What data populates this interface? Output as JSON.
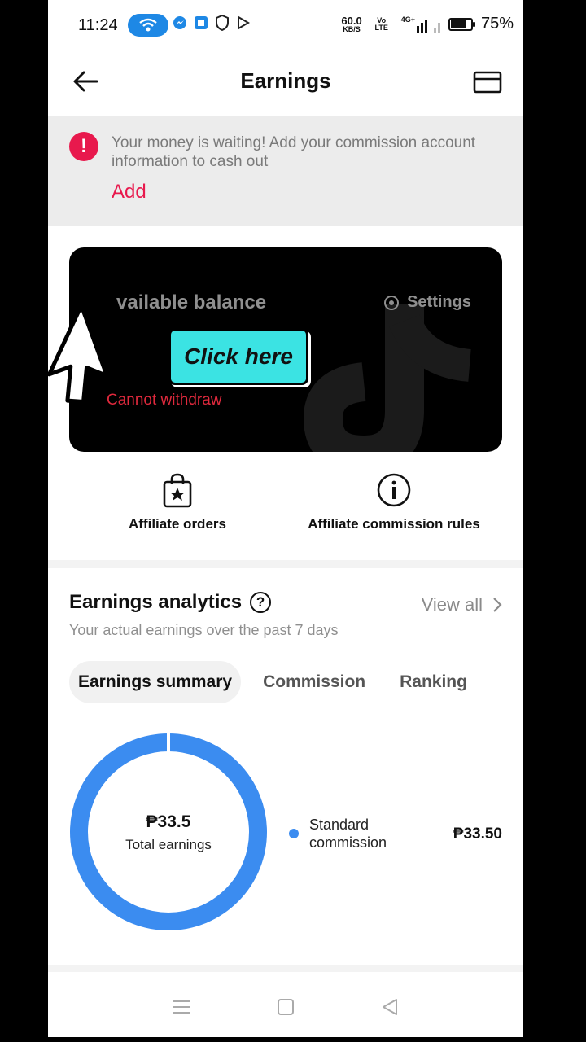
{
  "status_bar": {
    "time": "11:24",
    "net_speed": "60.0",
    "net_unit": "KB/S",
    "net_tech": "Vo LTE",
    "signal": "4G+",
    "battery": "75%"
  },
  "header": {
    "title": "Earnings"
  },
  "banner": {
    "message": "Your money is waiting! Add your commission account information to cash out",
    "action": "Add"
  },
  "balance_card": {
    "label": "vailable balance",
    "settings": "Settings",
    "status": "Cannot withdraw"
  },
  "overlay": {
    "click_here": "Click here"
  },
  "quick_actions": {
    "orders": "Affiliate orders",
    "rules": "Affiliate commission rules"
  },
  "analytics": {
    "title": "Earnings analytics",
    "view_all": "View all",
    "subtitle": "Your actual earnings over the past 7 days",
    "tabs": [
      "Earnings summary",
      "Commission",
      "Ranking"
    ],
    "total_amount": "₱33.5",
    "total_label": "Total earnings",
    "legend_label": "Standard commission",
    "legend_value": "₱33.50"
  },
  "colors": {
    "accent": "#e8194d",
    "chart": "#3b8cf0",
    "tiktok_cyan": "#3be3e3"
  },
  "icons": [
    "back-arrow-icon",
    "card-icon",
    "alert-icon",
    "gear-icon",
    "chevron-right-icon",
    "shopping-bag-icon",
    "info-icon",
    "help-icon",
    "cursor-icon",
    "menu-icon",
    "home-square-icon",
    "back-triangle-icon"
  ]
}
